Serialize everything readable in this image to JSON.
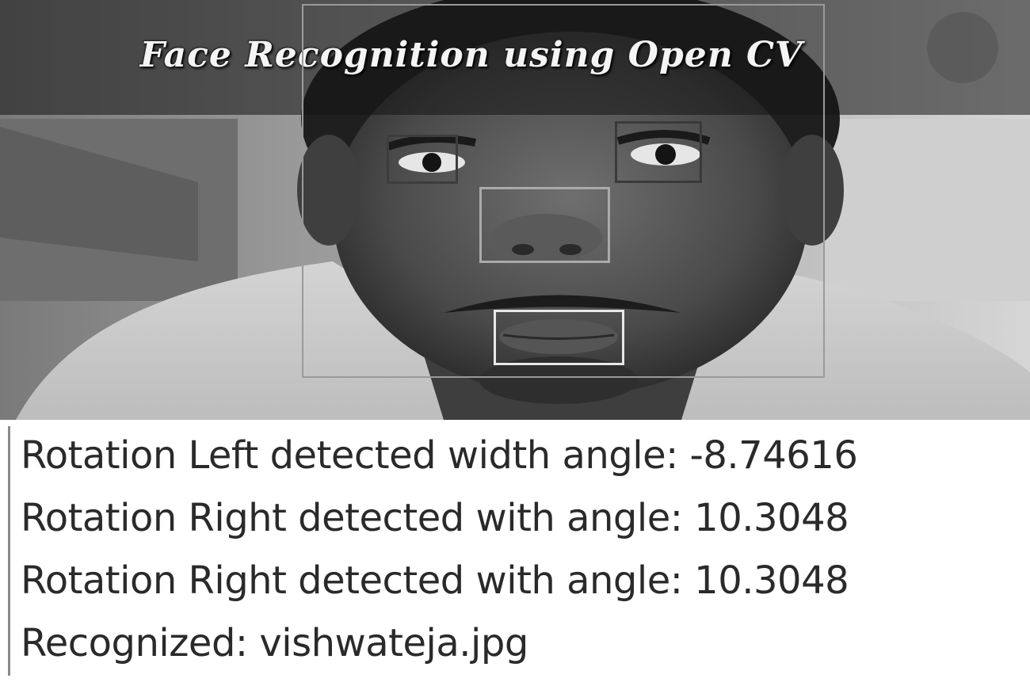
{
  "window": {
    "title": "Face Recognition using Open CV"
  },
  "detections": {
    "face": "face",
    "eyes": [
      "left-eye",
      "right-eye"
    ],
    "nose": "nose",
    "mouth": "mouth"
  },
  "console": {
    "lines": [
      "Rotation Left detected width angle: -8.74616",
      "Rotation Right detected with angle: 10.3048",
      "Rotation Right detected with angle: 10.3048",
      "Recognized: vishwateja.jpg"
    ]
  }
}
